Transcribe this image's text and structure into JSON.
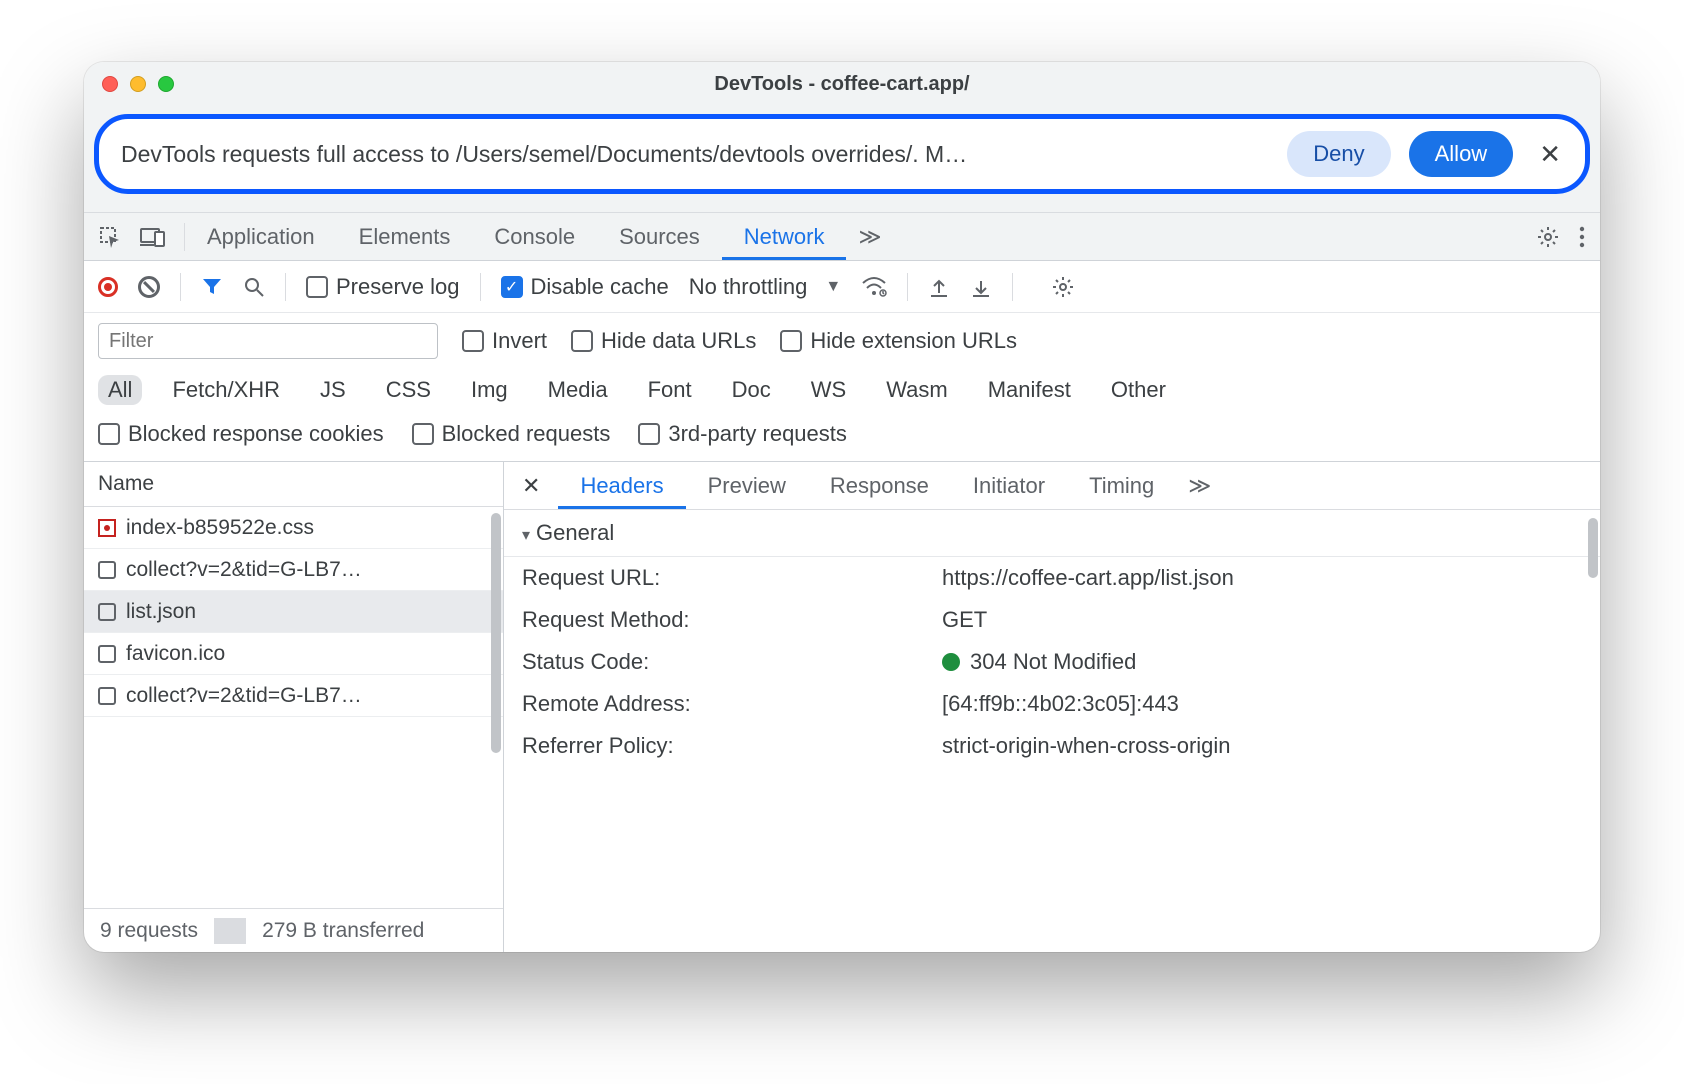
{
  "window": {
    "title": "DevTools - coffee-cart.app/"
  },
  "infobar": {
    "message": "DevTools requests full access to /Users/semel/Documents/devtools overrides/. M…",
    "deny": "Deny",
    "allow": "Allow"
  },
  "tabs": {
    "application": "Application",
    "elements": "Elements",
    "console": "Console",
    "sources": "Sources",
    "network": "Network"
  },
  "net_toolbar": {
    "preserve_log": "Preserve log",
    "disable_cache": "Disable cache",
    "throttling": "No throttling"
  },
  "filters": {
    "placeholder": "Filter",
    "invert": "Invert",
    "hide_data_urls": "Hide data URLs",
    "hide_extension_urls": "Hide extension URLs",
    "types": [
      "All",
      "Fetch/XHR",
      "JS",
      "CSS",
      "Img",
      "Media",
      "Font",
      "Doc",
      "WS",
      "Wasm",
      "Manifest",
      "Other"
    ],
    "blocked_cookies": "Blocked response cookies",
    "blocked_requests": "Blocked requests",
    "third_party": "3rd-party requests"
  },
  "left": {
    "header": "Name",
    "rows": [
      {
        "name": "index-b859522e.css",
        "icon": "override"
      },
      {
        "name": "collect?v=2&tid=G-LB7…",
        "icon": ""
      },
      {
        "name": "list.json",
        "icon": "",
        "selected": true
      },
      {
        "name": "favicon.ico",
        "icon": ""
      },
      {
        "name": "collect?v=2&tid=G-LB7…",
        "icon": ""
      }
    ],
    "status": {
      "requests": "9 requests",
      "transferred": "279 B transferred"
    }
  },
  "right": {
    "tabs": {
      "headers": "Headers",
      "preview": "Preview",
      "response": "Response",
      "initiator": "Initiator",
      "timing": "Timing"
    },
    "general_label": "General",
    "kv": {
      "request_url_k": "Request URL:",
      "request_url_v": "https://coffee-cart.app/list.json",
      "request_method_k": "Request Method:",
      "request_method_v": "GET",
      "status_code_k": "Status Code:",
      "status_code_v": "304 Not Modified",
      "remote_addr_k": "Remote Address:",
      "remote_addr_v": "[64:ff9b::4b02:3c05]:443",
      "referrer_k": "Referrer Policy:",
      "referrer_v": "strict-origin-when-cross-origin"
    }
  }
}
